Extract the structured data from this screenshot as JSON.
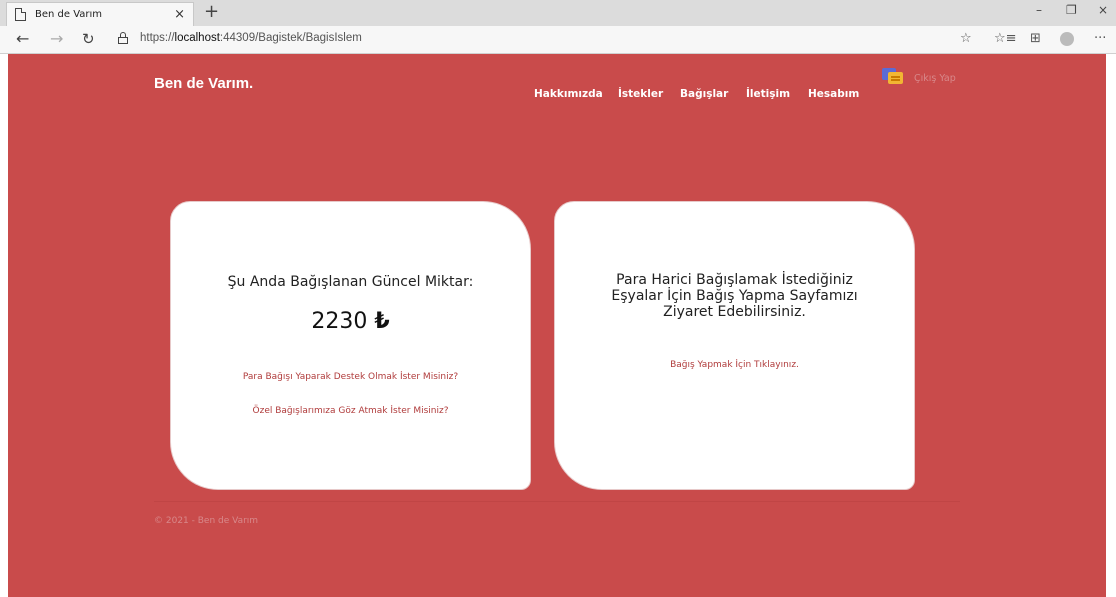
{
  "browser": {
    "tab_title": "Ben de Varım",
    "tab_close": "×",
    "new_tab": "+",
    "url_prefix": "https://",
    "url_host": "localhost",
    "url_rest": ":44309/Bagistek/BagisIslem",
    "window_controls": [
      "–",
      "❐",
      "×"
    ]
  },
  "site": {
    "brand": "Ben de Varım.",
    "nav": [
      "Hakkımızda",
      "İstekler",
      "Bağışlar",
      "İletişim",
      "Hesabım"
    ],
    "chat_label": "Çıkış Yap"
  },
  "left_card": {
    "label": "Şu Anda Bağışlanan Güncel Miktar:",
    "amount": "2230",
    "currency": "₺",
    "link1": "Para Bağışı Yaparak Destek Olmak İster Misiniz?",
    "link2": "Özel Bağışlarımıza Göz Atmak İster Misiniz?"
  },
  "right_card": {
    "title": "Para Harici Bağışlamak İstediğiniz Eşyalar İçin Bağış Yapma Sayfamızı Ziyaret Edebilirsiniz.",
    "link": "Bağış Yapmak İçin Tıklayınız."
  },
  "footer": {
    "text": "© 2021 - Ben de Varım"
  },
  "colors": {
    "page_bg": "#c94b4b",
    "link": "#b03c3c"
  }
}
